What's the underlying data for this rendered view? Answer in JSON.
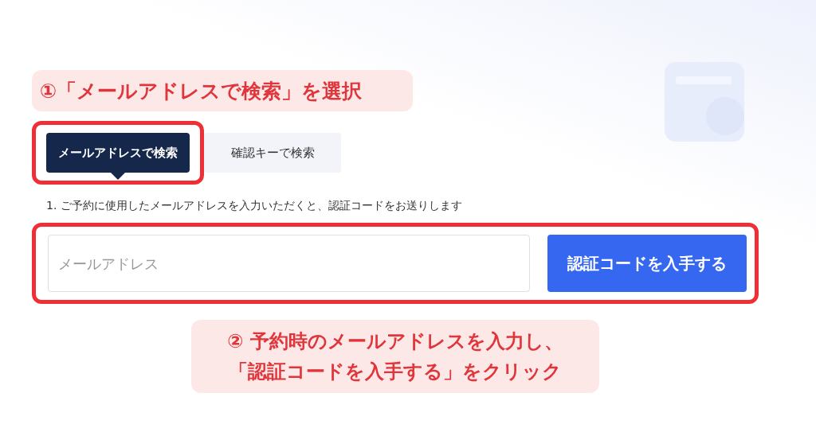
{
  "step_1_callout": "①「メールアドレスで検索」を選択",
  "tabs": [
    {
      "label": "メールアドレスで検索",
      "selected": true
    },
    {
      "label": "確認キーで検索",
      "selected": false
    }
  ],
  "instruction": "1. ご予約に使用したメールアドレスを入力いただくと、認証コードをお送りします",
  "email_field": {
    "placeholder": "メールアドレス"
  },
  "submit_button": "認証コードを入手する",
  "step_2_callout": [
    "② 予約時のメールアドレスを入力し、",
    "「認証コードを入手する」をクリック"
  ]
}
